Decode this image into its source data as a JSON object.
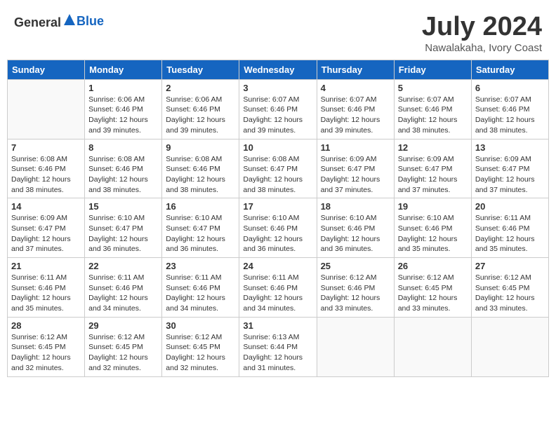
{
  "header": {
    "logo_general": "General",
    "logo_blue": "Blue",
    "month_title": "July 2024",
    "location": "Nawalakaha, Ivory Coast"
  },
  "weekdays": [
    "Sunday",
    "Monday",
    "Tuesday",
    "Wednesday",
    "Thursday",
    "Friday",
    "Saturday"
  ],
  "weeks": [
    [
      {
        "day": "",
        "info": ""
      },
      {
        "day": "1",
        "info": "Sunrise: 6:06 AM\nSunset: 6:46 PM\nDaylight: 12 hours\nand 39 minutes."
      },
      {
        "day": "2",
        "info": "Sunrise: 6:06 AM\nSunset: 6:46 PM\nDaylight: 12 hours\nand 39 minutes."
      },
      {
        "day": "3",
        "info": "Sunrise: 6:07 AM\nSunset: 6:46 PM\nDaylight: 12 hours\nand 39 minutes."
      },
      {
        "day": "4",
        "info": "Sunrise: 6:07 AM\nSunset: 6:46 PM\nDaylight: 12 hours\nand 39 minutes."
      },
      {
        "day": "5",
        "info": "Sunrise: 6:07 AM\nSunset: 6:46 PM\nDaylight: 12 hours\nand 38 minutes."
      },
      {
        "day": "6",
        "info": "Sunrise: 6:07 AM\nSunset: 6:46 PM\nDaylight: 12 hours\nand 38 minutes."
      }
    ],
    [
      {
        "day": "7",
        "info": "Sunrise: 6:08 AM\nSunset: 6:46 PM\nDaylight: 12 hours\nand 38 minutes."
      },
      {
        "day": "8",
        "info": "Sunrise: 6:08 AM\nSunset: 6:46 PM\nDaylight: 12 hours\nand 38 minutes."
      },
      {
        "day": "9",
        "info": "Sunrise: 6:08 AM\nSunset: 6:46 PM\nDaylight: 12 hours\nand 38 minutes."
      },
      {
        "day": "10",
        "info": "Sunrise: 6:08 AM\nSunset: 6:47 PM\nDaylight: 12 hours\nand 38 minutes."
      },
      {
        "day": "11",
        "info": "Sunrise: 6:09 AM\nSunset: 6:47 PM\nDaylight: 12 hours\nand 37 minutes."
      },
      {
        "day": "12",
        "info": "Sunrise: 6:09 AM\nSunset: 6:47 PM\nDaylight: 12 hours\nand 37 minutes."
      },
      {
        "day": "13",
        "info": "Sunrise: 6:09 AM\nSunset: 6:47 PM\nDaylight: 12 hours\nand 37 minutes."
      }
    ],
    [
      {
        "day": "14",
        "info": "Sunrise: 6:09 AM\nSunset: 6:47 PM\nDaylight: 12 hours\nand 37 minutes."
      },
      {
        "day": "15",
        "info": "Sunrise: 6:10 AM\nSunset: 6:47 PM\nDaylight: 12 hours\nand 36 minutes."
      },
      {
        "day": "16",
        "info": "Sunrise: 6:10 AM\nSunset: 6:47 PM\nDaylight: 12 hours\nand 36 minutes."
      },
      {
        "day": "17",
        "info": "Sunrise: 6:10 AM\nSunset: 6:46 PM\nDaylight: 12 hours\nand 36 minutes."
      },
      {
        "day": "18",
        "info": "Sunrise: 6:10 AM\nSunset: 6:46 PM\nDaylight: 12 hours\nand 36 minutes."
      },
      {
        "day": "19",
        "info": "Sunrise: 6:10 AM\nSunset: 6:46 PM\nDaylight: 12 hours\nand 35 minutes."
      },
      {
        "day": "20",
        "info": "Sunrise: 6:11 AM\nSunset: 6:46 PM\nDaylight: 12 hours\nand 35 minutes."
      }
    ],
    [
      {
        "day": "21",
        "info": "Sunrise: 6:11 AM\nSunset: 6:46 PM\nDaylight: 12 hours\nand 35 minutes."
      },
      {
        "day": "22",
        "info": "Sunrise: 6:11 AM\nSunset: 6:46 PM\nDaylight: 12 hours\nand 34 minutes."
      },
      {
        "day": "23",
        "info": "Sunrise: 6:11 AM\nSunset: 6:46 PM\nDaylight: 12 hours\nand 34 minutes."
      },
      {
        "day": "24",
        "info": "Sunrise: 6:11 AM\nSunset: 6:46 PM\nDaylight: 12 hours\nand 34 minutes."
      },
      {
        "day": "25",
        "info": "Sunrise: 6:12 AM\nSunset: 6:46 PM\nDaylight: 12 hours\nand 33 minutes."
      },
      {
        "day": "26",
        "info": "Sunrise: 6:12 AM\nSunset: 6:45 PM\nDaylight: 12 hours\nand 33 minutes."
      },
      {
        "day": "27",
        "info": "Sunrise: 6:12 AM\nSunset: 6:45 PM\nDaylight: 12 hours\nand 33 minutes."
      }
    ],
    [
      {
        "day": "28",
        "info": "Sunrise: 6:12 AM\nSunset: 6:45 PM\nDaylight: 12 hours\nand 32 minutes."
      },
      {
        "day": "29",
        "info": "Sunrise: 6:12 AM\nSunset: 6:45 PM\nDaylight: 12 hours\nand 32 minutes."
      },
      {
        "day": "30",
        "info": "Sunrise: 6:12 AM\nSunset: 6:45 PM\nDaylight: 12 hours\nand 32 minutes."
      },
      {
        "day": "31",
        "info": "Sunrise: 6:13 AM\nSunset: 6:44 PM\nDaylight: 12 hours\nand 31 minutes."
      },
      {
        "day": "",
        "info": ""
      },
      {
        "day": "",
        "info": ""
      },
      {
        "day": "",
        "info": ""
      }
    ]
  ]
}
